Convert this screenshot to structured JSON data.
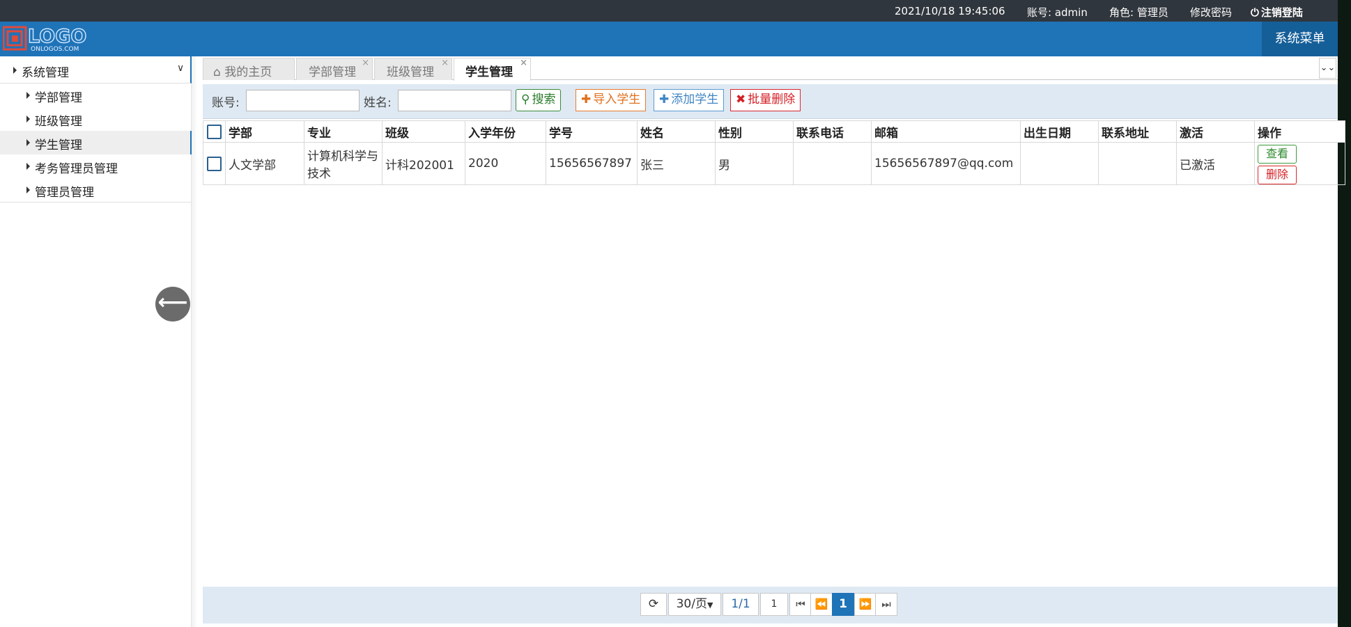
{
  "topbar": {
    "datetime": "2021/10/18 19:45:06",
    "account": "账号: admin",
    "role": "角色: 管理员",
    "change_password": "修改密码",
    "logout": "注销登陆"
  },
  "header": {
    "logo_text": "LOGO",
    "logo_sub": "ONLOGOS.COM",
    "system_menu": "系统菜单"
  },
  "sidebar": {
    "group": "系统管理",
    "items": [
      {
        "label": "学部管理",
        "active": false
      },
      {
        "label": "班级管理",
        "active": false
      },
      {
        "label": "学生管理",
        "active": true
      },
      {
        "label": "考务管理员管理",
        "active": false
      },
      {
        "label": "管理员管理",
        "active": false
      }
    ]
  },
  "tabs": [
    {
      "label": "我的主页",
      "closable": false
    },
    {
      "label": "学部管理",
      "closable": true
    },
    {
      "label": "班级管理",
      "closable": true
    },
    {
      "label": "学生管理",
      "closable": true,
      "active": true
    }
  ],
  "toolbar": {
    "account_label": "账号:",
    "name_label": "姓名:",
    "account_value": "",
    "name_value": "",
    "search": "搜索",
    "import": "导入学生",
    "add": "添加学生",
    "batch_delete": "批量删除"
  },
  "table": {
    "columns": [
      "学部",
      "专业",
      "班级",
      "入学年份",
      "学号",
      "姓名",
      "性别",
      "联系电话",
      "邮箱",
      "出生日期",
      "联系地址",
      "激活",
      "操作"
    ],
    "rows": [
      {
        "dept": "人文学部",
        "major": "计算机科学与技术",
        "class": "计科202001",
        "year": "2020",
        "student_id": "15656567897",
        "name": "张三",
        "gender": "男",
        "phone": "",
        "email": "15656567897@qq.com",
        "birth": "",
        "address": "",
        "active": "已激活",
        "view": "查看",
        "delete": "删除"
      }
    ]
  },
  "pager": {
    "page_size": "30/页",
    "page_info": "1/1",
    "page_input": "1",
    "current_page": "1"
  },
  "colors": {
    "header_blue": "#1f73b7",
    "topbar_dark": "#30363d",
    "toolbar_bg": "#dfe9f3"
  }
}
